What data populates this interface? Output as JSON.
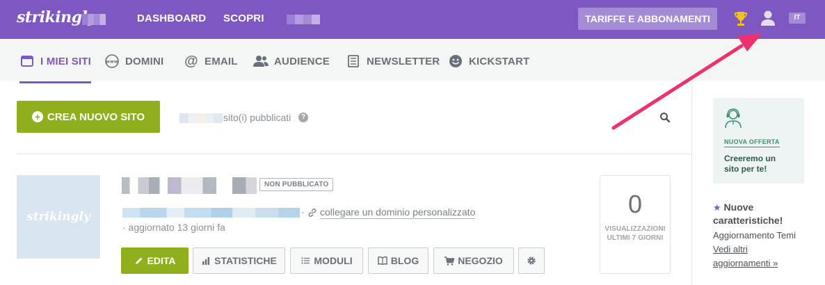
{
  "header": {
    "logo": "strikingly",
    "nav": [
      {
        "label": "DASHBOARD"
      },
      {
        "label": "SCOPRI"
      }
    ],
    "pricing_button": "TARIFFE E ABBONAMENTI",
    "language": "IT"
  },
  "subnav": {
    "items": [
      {
        "label": "I MIEI SITI",
        "icon": "calendar-window-icon",
        "active": true
      },
      {
        "label": "DOMINI",
        "icon": "www-icon"
      },
      {
        "label": "EMAIL",
        "icon": "at-icon"
      },
      {
        "label": "AUDIENCE",
        "icon": "people-icon"
      },
      {
        "label": "NEWSLETTER",
        "icon": "newspaper-icon"
      },
      {
        "label": "KICKSTART",
        "icon": "smiley-icon"
      }
    ]
  },
  "toolbar": {
    "create_button": "CREA NUOVO SITO",
    "published_text": "sito(i) pubblicati"
  },
  "site": {
    "thumbnail_text": "strikingly",
    "status_badge": "NON PUBBLICATO",
    "custom_domain_link": "collegare un dominio personalizzato",
    "updated": "· aggiornato 13 giorni fa",
    "actions": {
      "edit": "EDITA",
      "stats": "STATISTICHE",
      "modules": "MODULI",
      "blog": "BLOG",
      "shop": "NEGOZIO"
    },
    "views": {
      "count": "0",
      "label_line1": "VISUALIZZAZIONI",
      "label_line2": "ULTIMI 7 GIORNI"
    }
  },
  "sidebar": {
    "offer_tag": "NUOVA OFFERTA",
    "offer_line1": "Creeremo un",
    "offer_line2": "sito per te!",
    "news_title_1": "Nuove",
    "news_title_2": "caratteristiche!",
    "news_subtitle": "Aggiornamento Temi",
    "news_link_1": "Vedi altri",
    "news_link_2": "aggiornamenti »"
  },
  "colors": {
    "brand_purple": "#7e58c1",
    "green": "#8fb01c",
    "annotation_arrow": "#f0306a"
  }
}
